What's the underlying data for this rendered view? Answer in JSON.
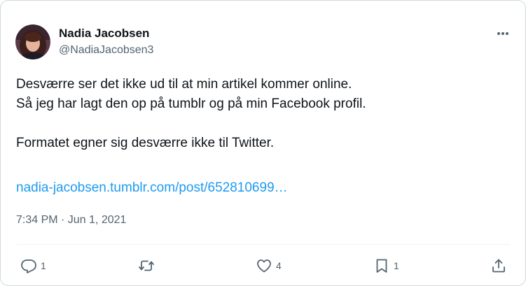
{
  "author": {
    "name": "Nadia Jacobsen",
    "handle": "@NadiaJacobsen3"
  },
  "tweet": {
    "line1": "Desværre ser det ikke ud til at min artikel kommer online.",
    "line2": "Så jeg har lagt den op på tumblr og på min Facebook profil.",
    "line3": "Formatet egner sig desværre ikke til Twitter.",
    "link": "nadia-jacobsen.tumblr.com/post/652810699…",
    "timestamp": "7:34 PM · Jun 1, 2021"
  },
  "actions": {
    "reply_count": "1",
    "like_count": "4",
    "bookmark_count": "1"
  },
  "icons": [
    "more-icon",
    "reply-icon",
    "retweet-icon",
    "like-icon",
    "bookmark-icon",
    "share-icon"
  ],
  "colors": {
    "text": "#0f1419",
    "secondary": "#536471",
    "link": "#1d9bf0",
    "border": "#cfd9de"
  }
}
